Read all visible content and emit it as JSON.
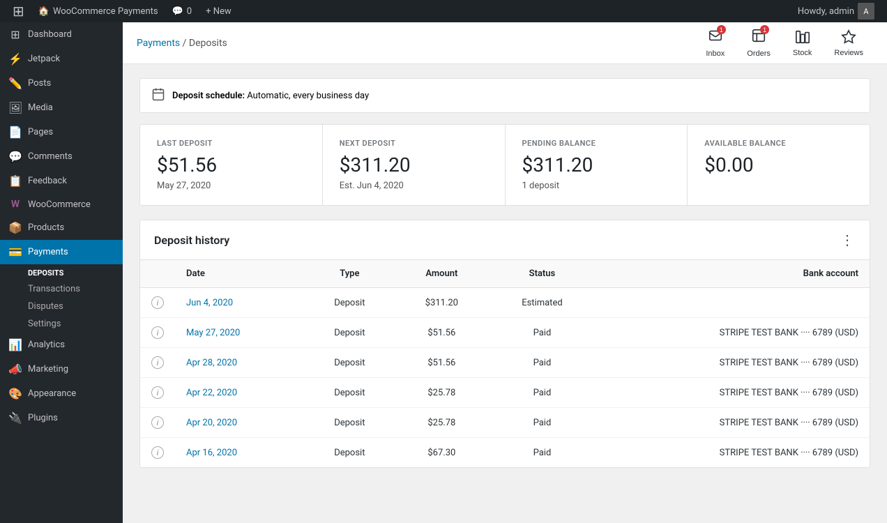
{
  "admin_bar": {
    "wp_logo": "⊞",
    "site_name": "WooCommerce Payments",
    "comments_icon": "💬",
    "comments_count": "0",
    "new_label": "+ New",
    "howdy": "Howdy, admin",
    "avatar": "👤"
  },
  "sidebar": {
    "items": [
      {
        "id": "dashboard",
        "label": "Dashboard",
        "icon": "⊞"
      },
      {
        "id": "jetpack",
        "label": "Jetpack",
        "icon": "⚡"
      },
      {
        "id": "posts",
        "label": "Posts",
        "icon": "📝"
      },
      {
        "id": "media",
        "label": "Media",
        "icon": "🖼"
      },
      {
        "id": "pages",
        "label": "Pages",
        "icon": "📄"
      },
      {
        "id": "comments",
        "label": "Comments",
        "icon": "💬"
      },
      {
        "id": "feedback",
        "label": "Feedback",
        "icon": "📋"
      },
      {
        "id": "woocommerce",
        "label": "WooCommerce",
        "icon": "🛒"
      },
      {
        "id": "products",
        "label": "Products",
        "icon": "📦"
      },
      {
        "id": "payments",
        "label": "Payments",
        "icon": "💳"
      }
    ],
    "payments_sub": [
      {
        "id": "deposits",
        "label": "Deposits",
        "active": true
      },
      {
        "id": "transactions",
        "label": "Transactions"
      },
      {
        "id": "disputes",
        "label": "Disputes"
      },
      {
        "id": "settings",
        "label": "Settings"
      }
    ],
    "bottom_items": [
      {
        "id": "analytics",
        "label": "Analytics",
        "icon": "📊"
      },
      {
        "id": "marketing",
        "label": "Marketing",
        "icon": "📣"
      },
      {
        "id": "appearance",
        "label": "Appearance",
        "icon": "🎨"
      },
      {
        "id": "plugins",
        "label": "Plugins",
        "icon": "🔌"
      }
    ]
  },
  "top_icons": [
    {
      "id": "inbox",
      "label": "Inbox",
      "badge": "1"
    },
    {
      "id": "orders",
      "label": "Orders",
      "badge": "1"
    },
    {
      "id": "stock",
      "label": "Stock",
      "badge": null
    },
    {
      "id": "reviews",
      "label": "Reviews",
      "badge": null
    }
  ],
  "breadcrumb": {
    "parent_label": "Payments",
    "separator": "/",
    "current": "Deposits"
  },
  "deposit_schedule": {
    "icon": "📅",
    "text_bold": "Deposit schedule:",
    "text_regular": "Automatic, every business day"
  },
  "stats": [
    {
      "id": "last-deposit",
      "label": "LAST DEPOSIT",
      "value": "$51.56",
      "sub": "May 27, 2020"
    },
    {
      "id": "next-deposit",
      "label": "NEXT DEPOSIT",
      "value": "$311.20",
      "sub": "Est. Jun 4, 2020"
    },
    {
      "id": "pending-balance",
      "label": "PENDING BALANCE",
      "value": "$311.20",
      "sub": "1 deposit"
    },
    {
      "id": "available-balance",
      "label": "AVAILABLE BALANCE",
      "value": "$0.00",
      "sub": ""
    }
  ],
  "history": {
    "title": "Deposit history",
    "columns": [
      "Date",
      "Type",
      "Amount",
      "Status",
      "Bank account"
    ],
    "rows": [
      {
        "date": "Jun 4, 2020",
        "type": "Deposit",
        "amount": "$311.20",
        "status": "Estimated",
        "bank": ""
      },
      {
        "date": "May 27, 2020",
        "type": "Deposit",
        "amount": "$51.56",
        "status": "Paid",
        "bank": "STRIPE TEST BANK ···· 6789 (USD)"
      },
      {
        "date": "Apr 28, 2020",
        "type": "Deposit",
        "amount": "$51.56",
        "status": "Paid",
        "bank": "STRIPE TEST BANK ···· 6789 (USD)"
      },
      {
        "date": "Apr 22, 2020",
        "type": "Deposit",
        "amount": "$25.78",
        "status": "Paid",
        "bank": "STRIPE TEST BANK ···· 6789 (USD)"
      },
      {
        "date": "Apr 20, 2020",
        "type": "Deposit",
        "amount": "$25.78",
        "status": "Paid",
        "bank": "STRIPE TEST BANK ···· 6789 (USD)"
      },
      {
        "date": "Apr 16, 2020",
        "type": "Deposit",
        "amount": "$67.30",
        "status": "Paid",
        "bank": "STRIPE TEST BANK ···· 6789 (USD)"
      }
    ]
  }
}
